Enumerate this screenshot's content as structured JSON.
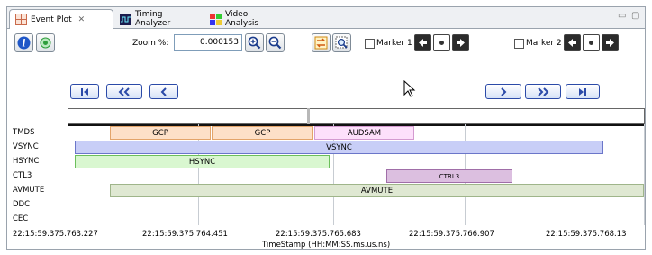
{
  "tabs": [
    {
      "label": "Event Plot",
      "close": "✕",
      "icon": "event-plot-icon"
    },
    {
      "label": "Timing Analyzer",
      "icon": "timing-analyzer-icon"
    },
    {
      "label": "Video Analysis",
      "icon": "video-analysis-icon"
    }
  ],
  "window_controls": {
    "minimize": "▭",
    "maximize": "▢"
  },
  "toolbar": {
    "zoom_label": "Zoom %:",
    "zoom_value": "0.000153",
    "marker1_label": "Marker 1",
    "marker2_label": "Marker 2",
    "marker1_checked": false,
    "marker2_checked": false
  },
  "nav": {
    "first": "⏮",
    "prev_page": "«",
    "prev": "‹",
    "next": "›",
    "next_page": "»",
    "last": "⏭"
  },
  "signals": [
    {
      "name": "TMDS"
    },
    {
      "name": "VSYNC"
    },
    {
      "name": "HSYNC"
    },
    {
      "name": "CTL3"
    },
    {
      "name": "AVMUTE"
    },
    {
      "name": "DDC"
    },
    {
      "name": "CEC"
    }
  ],
  "events": [
    {
      "signal": "TMDS",
      "label": "GCP",
      "color": "#fde0c8",
      "border": "#e3a46a"
    },
    {
      "signal": "TMDS",
      "label": "GCP",
      "color": "#fde0c8",
      "border": "#e3a46a"
    },
    {
      "signal": "TMDS",
      "label": "AUDSAM",
      "color": "#fde0fb",
      "border": "#d49ad0"
    },
    {
      "signal": "VSYNC",
      "label": "VSYNC",
      "color": "#c8cef7",
      "border": "#6b76c9"
    },
    {
      "signal": "HSYNC",
      "label": "HSYNC",
      "color": "#d9f7d0",
      "border": "#6cbf5c"
    },
    {
      "signal": "CTL3",
      "label": "CTRL3",
      "color": "#dcbfe0",
      "border": "#a06ea8"
    },
    {
      "signal": "AVMUTE",
      "label": "AVMUTE",
      "color": "#dfe8d2",
      "border": "#9fb58a"
    }
  ],
  "axis": {
    "ticks": [
      "22:15:59.375.763.227",
      "22:15:59.375.764.451",
      "22:15:59.375.765.683",
      "22:15:59.375.766.907",
      "22:15:59.375.768.13"
    ],
    "label": "TimeStamp (HH:MM:SS.ms.us.ns)"
  },
  "colors": {
    "nav_accent": "#2b4aa8",
    "grid": "#c7ccd2",
    "info_button": "#1f57c7",
    "record_button": "#2e9d3b"
  }
}
